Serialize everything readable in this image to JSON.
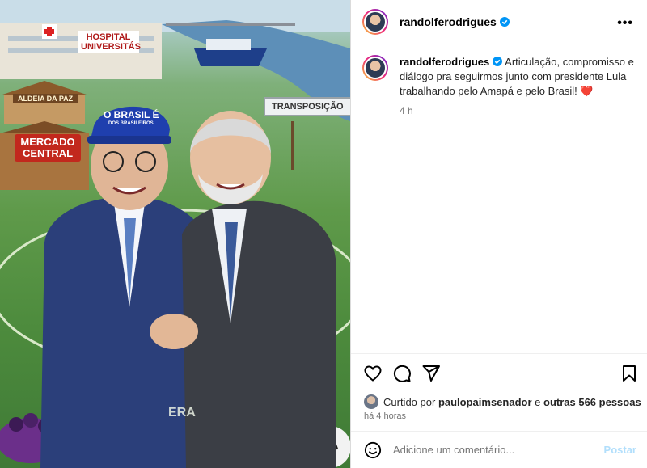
{
  "post": {
    "username": "randolferodrigues",
    "caption_user": "randolferodrigues",
    "caption_text": "Articulação, compromisso e diálogo pra seguirmos junto com presidente Lula trabalhando pelo Amapá e pelo Brasil!",
    "caption_emoji": "❤️",
    "caption_time": "4 h",
    "liked_prefix": "Curtido por",
    "liked_user": "paulopaimsenador",
    "liked_mid": "e",
    "liked_others": "outras 566 pessoas",
    "time_ago": "há 4 horas",
    "comment_placeholder": "Adicione um comentário...",
    "post_label": "Postar"
  },
  "image_text": {
    "hospital": "HOSPITAL UNIVERSITÁS",
    "aldeia": "ALDEIA DA PAZ",
    "mercado": "MERCADO CENTRAL",
    "transposicao": "TRANSPOSIÇÃO",
    "cap_line1": "O BRASIL É",
    "cap_line2": "DOS BRASILEIROS",
    "bottom": "ERA"
  },
  "icons": {
    "more": "more-options-icon",
    "verified": "verified-badge-icon",
    "like": "heart-icon",
    "comment": "comment-icon",
    "share": "share-icon",
    "save": "bookmark-icon",
    "emoji": "emoji-icon"
  },
  "colors": {
    "verified": "#0095f6",
    "post_disabled": "#b2dffc",
    "muted": "#737373"
  }
}
